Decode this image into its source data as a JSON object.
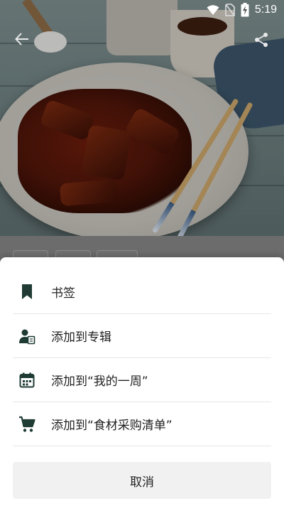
{
  "status_bar": {
    "time": "5:19",
    "icons": [
      "wifi-icon",
      "no-sim-icon",
      "battery-charging-icon"
    ]
  },
  "toolbar": {
    "back_icon": "arrow-left-icon",
    "share_icon": "share-icon"
  },
  "sheet": {
    "items": [
      {
        "label": "书签",
        "icon": "bookmark-icon"
      },
      {
        "label": "添加到专辑",
        "icon": "album-user-icon"
      },
      {
        "label": "添加到“我的一周”",
        "icon": "calendar-icon"
      },
      {
        "label": "添加到“食材采购清单”",
        "icon": "cart-icon"
      }
    ],
    "cancel_label": "取消"
  },
  "colors": {
    "icon_dark_green": "#1f3b34",
    "sheet_bg": "#ffffff",
    "cancel_bg": "#f1f1f1"
  }
}
